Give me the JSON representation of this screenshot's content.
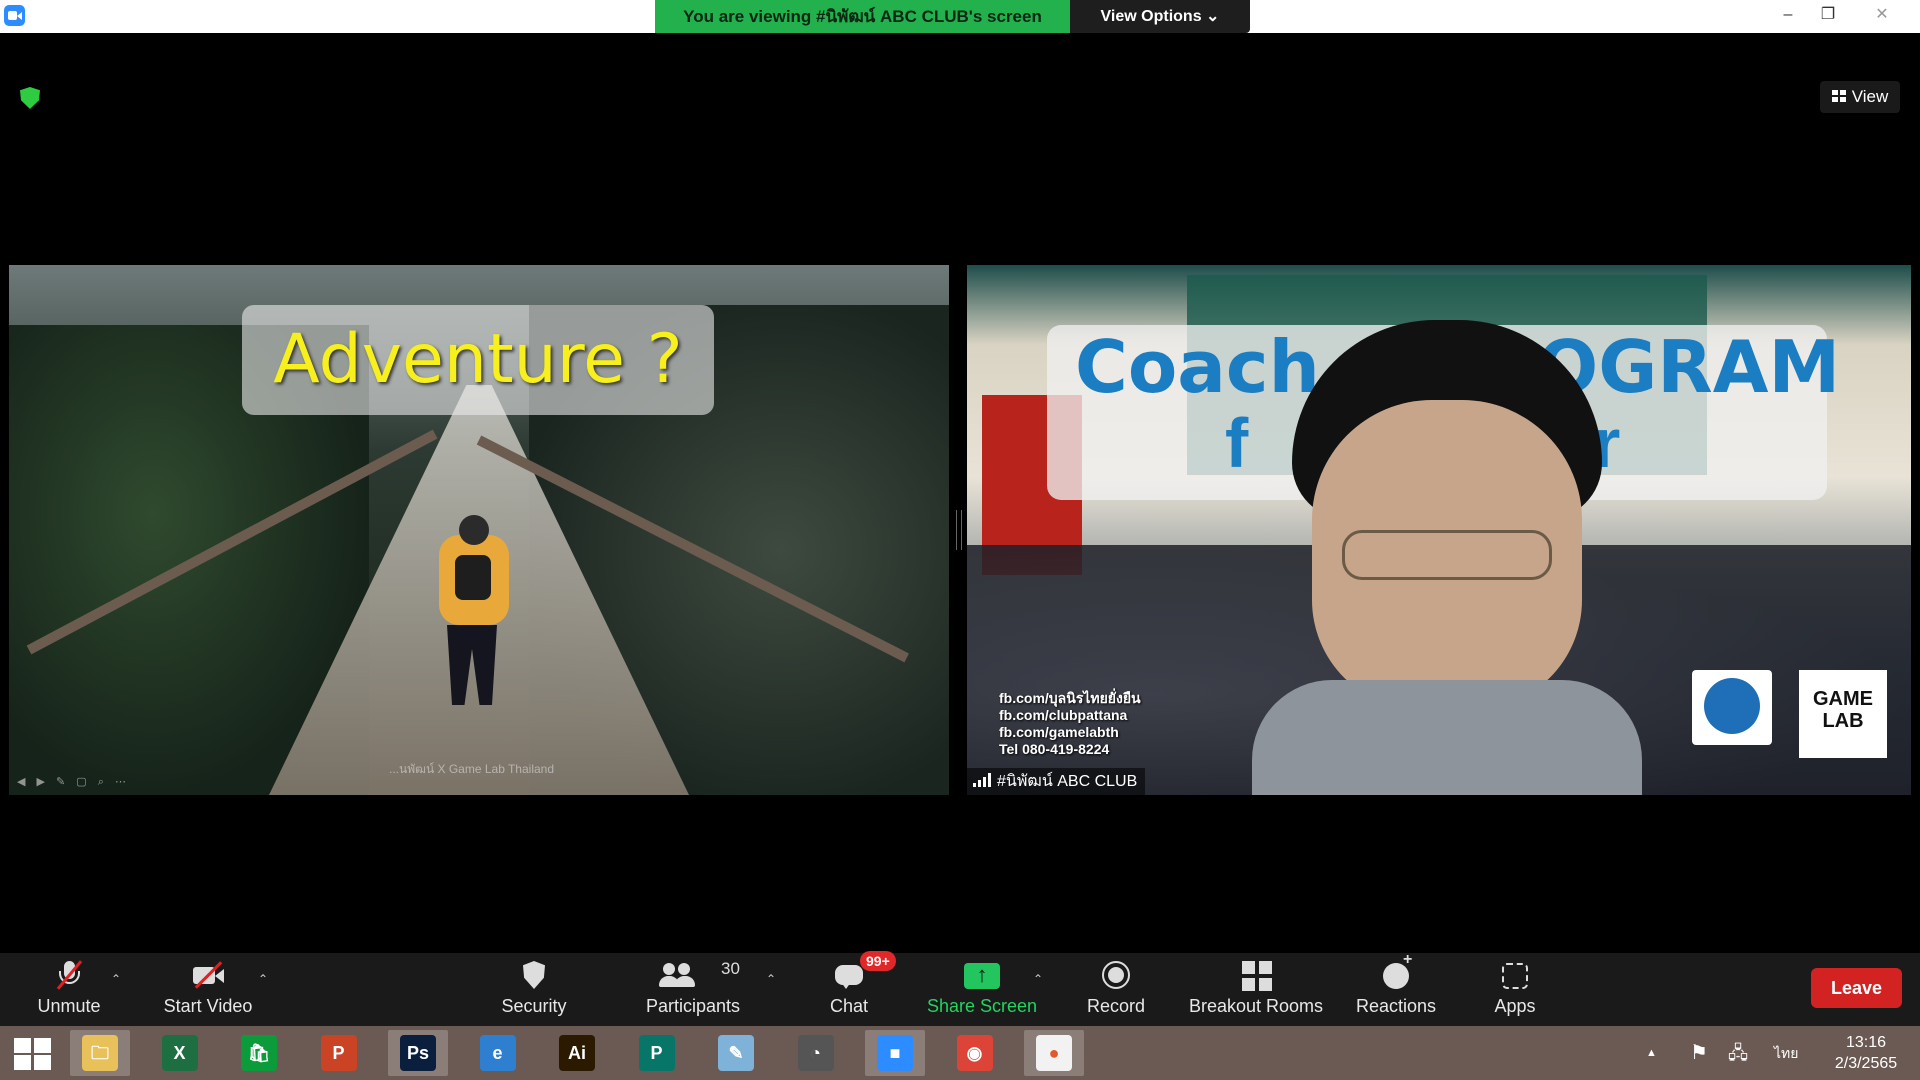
{
  "titlebar": {
    "viewing_banner": "You are viewing #นิพัฒน์ ABC CLUB's screen",
    "view_options": "View Options",
    "view_options_chevron": "⌄",
    "minimize": "–",
    "restore": "❐",
    "close": "✕"
  },
  "stage": {
    "view_button": "View",
    "shared_screen": {
      "slide_title": "Adventure ?",
      "slide_credit": "...นพัฒน์ X Game Lab Thailand",
      "slide_tools": "◀ ▶ ✎ ▢ ⌕ ⋯"
    },
    "participant": {
      "name": "#นิพัฒน์ ABC CLUB",
      "background_text_coach": "Coach",
      "background_text_program": "OGRAM",
      "background_text_f": "f",
      "background_text_rer": "rer",
      "contacts": [
        "fb.com/บุลนิรไทยยั่งยืน",
        "fb.com/clubpattana",
        "fb.com/gamelabth",
        "Tel 080-419-8224"
      ],
      "logo_game_line1": "GAME",
      "logo_game_line2": "LAB"
    }
  },
  "toolbar": {
    "unmute": "Unmute",
    "start_video": "Start Video",
    "security": "Security",
    "participants": "Participants",
    "participants_count": "30",
    "chat": "Chat",
    "chat_badge": "99+",
    "share_screen": "Share Screen",
    "record": "Record",
    "breakout_rooms": "Breakout Rooms",
    "reactions": "Reactions",
    "apps": "Apps",
    "leave": "Leave",
    "caret": "⌃",
    "accent_green": "#22d45f",
    "leave_color": "#d32222"
  },
  "taskbar": {
    "apps": [
      {
        "name": "file-explorer",
        "glyph": "🗀",
        "color": "#e8c15a"
      },
      {
        "name": "excel",
        "glyph": "X",
        "color": "#1d6f42"
      },
      {
        "name": "store",
        "glyph": "🛍",
        "color": "#0c9b3a"
      },
      {
        "name": "powerpoint",
        "glyph": "P",
        "color": "#c94324"
      },
      {
        "name": "photoshop",
        "glyph": "Ps",
        "color": "#0a1f3e"
      },
      {
        "name": "internet-explorer",
        "glyph": "e",
        "color": "#2f7fd1"
      },
      {
        "name": "illustrator",
        "glyph": "Ai",
        "color": "#2b1a00"
      },
      {
        "name": "publisher",
        "glyph": "P",
        "color": "#077568"
      },
      {
        "name": "notepad",
        "glyph": "✎",
        "color": "#7fb2d9"
      },
      {
        "name": "photoscape",
        "glyph": "◔",
        "color": "#555555"
      },
      {
        "name": "zoom",
        "glyph": "■",
        "color": "#2d8cff"
      },
      {
        "name": "chrome",
        "glyph": "◉",
        "color": "#db4437"
      },
      {
        "name": "paint",
        "glyph": "●",
        "color": "#f2f2f2"
      }
    ],
    "tray_up": "▲",
    "tray_flag": "⚑",
    "tray_network": "🖧",
    "language": "ไทย",
    "time": "13:16",
    "date": "2/3/2565"
  }
}
